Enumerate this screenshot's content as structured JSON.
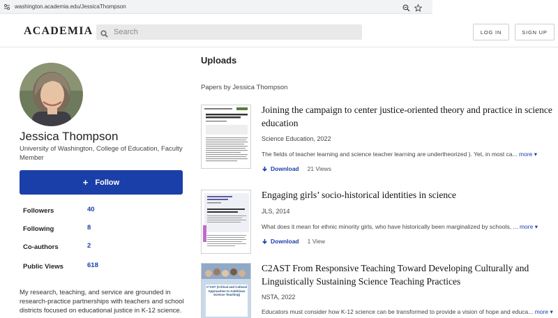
{
  "browser": {
    "url": "washington.academia.edu/JessicaThompson"
  },
  "header": {
    "logo": "ACADEMIA",
    "search_placeholder": "Search",
    "login_label": "LOG IN",
    "signup_label": "SIGN UP"
  },
  "profile": {
    "name": "Jessica Thompson",
    "affiliation": "University of Washington, College of Education, Faculty Member",
    "follow_label": "Follow",
    "stats": [
      {
        "label": "Followers",
        "value": "40"
      },
      {
        "label": "Following",
        "value": "8"
      },
      {
        "label": "Co-authors",
        "value": "2"
      },
      {
        "label": "Public Views",
        "value": "618"
      }
    ],
    "bio": "My research, teaching, and service are grounded in research-practice partnerships with teachers and school districts focused on educational justice in K-12 science."
  },
  "uploads": {
    "title": "Uploads",
    "subtitle": "Papers by Jessica Thompson",
    "papers": [
      {
        "title": "Joining the campaign to center justice-oriented theory and practice in science education",
        "meta": "Science Education, 2022",
        "abstract": "The fields of teacher learning and science teacher learning are undertheorized ). Yet, in most ca...",
        "more_label": "more",
        "download_label": "Download",
        "views": "21 Views"
      },
      {
        "title": "Engaging girls’ socio-historical identities in science",
        "meta": "JLS, 2014",
        "abstract": "What does it mean for ethnic minority girls, who have historically been marginalized by schools, ...",
        "more_label": "more",
        "download_label": "Download",
        "views": "1 View"
      },
      {
        "title": "C2AST From Responsive Teaching Toward Developing Culturally and Linguistically Sustaining Science Teaching Practices",
        "meta": "NSTA, 2022",
        "abstract": "Educators must consider how K-12 science can be transformed to provide a vision of hope and educa...",
        "more_label": "more",
        "thumb_title": "C²AST (Critical and Cultural Approaches to Ambitious Science Teaching)"
      }
    ]
  },
  "colors": {
    "accent": "#1b3fa8",
    "search_bg": "#e9e9e9"
  }
}
